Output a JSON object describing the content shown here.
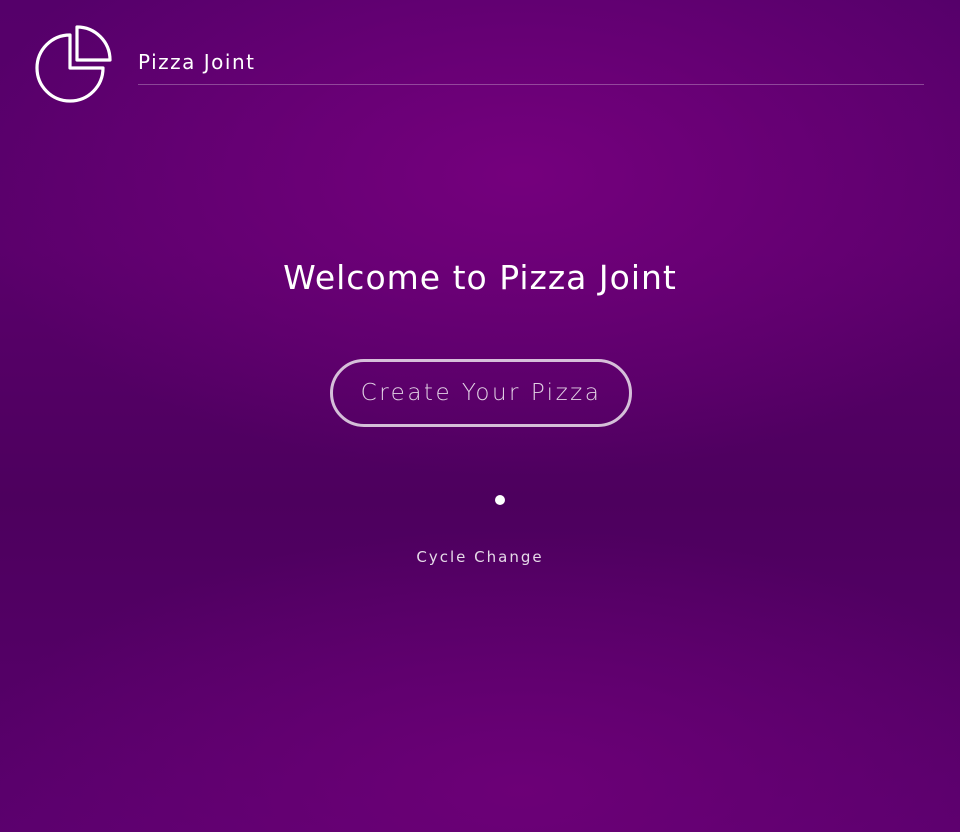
{
  "header": {
    "logo_icon": "pie-chart-icon",
    "brand_name": "Pizza Joint"
  },
  "home": {
    "title": "Welcome to Pizza Joint",
    "cta_label": "Create Your Pizza",
    "indicator_icon": "dot-icon",
    "cycle_label": "Cycle Change"
  },
  "colors": {
    "background": "#5a006b",
    "text": "#ffffff",
    "button_border": "#e0c6e6"
  }
}
